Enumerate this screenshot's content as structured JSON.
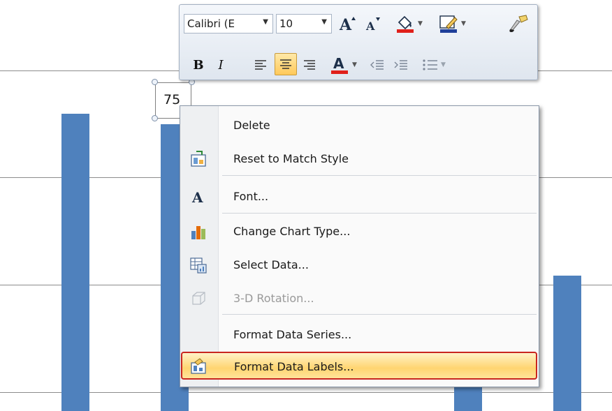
{
  "chart": {
    "selected_label_value": "75",
    "bar_color": "#4f81bd"
  },
  "mini_toolbar": {
    "font_name": "Calibri (E",
    "font_size": "10",
    "icons": [
      "grow-font-icon",
      "shrink-font-icon",
      "fill-color-icon",
      "line-color-icon",
      "format-painter-icon",
      "bold-icon",
      "italic-icon",
      "align-left-icon",
      "align-center-icon",
      "align-right-icon",
      "font-color-icon",
      "decrease-indent-icon",
      "increase-indent-icon",
      "bullets-icon"
    ],
    "active_button": "align-center",
    "font_color": "#e0201b"
  },
  "context_menu": {
    "items": [
      {
        "label": "Delete",
        "icon": "none",
        "enabled": true
      },
      {
        "label": "Reset to Match Style",
        "icon": "reset-style-icon",
        "enabled": true
      },
      {
        "label": "Font...",
        "icon": "font-icon",
        "enabled": true
      },
      {
        "label": "Change Chart Type...",
        "icon": "chart-type-icon",
        "enabled": true
      },
      {
        "label": "Select Data...",
        "icon": "select-data-icon",
        "enabled": true
      },
      {
        "label": "3-D Rotation...",
        "icon": "3d-rotation-icon",
        "enabled": false
      },
      {
        "label": "Format Data Series...",
        "icon": "none",
        "enabled": true
      },
      {
        "label": "Format Data Labels...",
        "icon": "format-labels-icon",
        "enabled": true,
        "highlighted": true
      }
    ],
    "highlight_color": "#ffd571",
    "highlight_border": "#c8261f"
  }
}
